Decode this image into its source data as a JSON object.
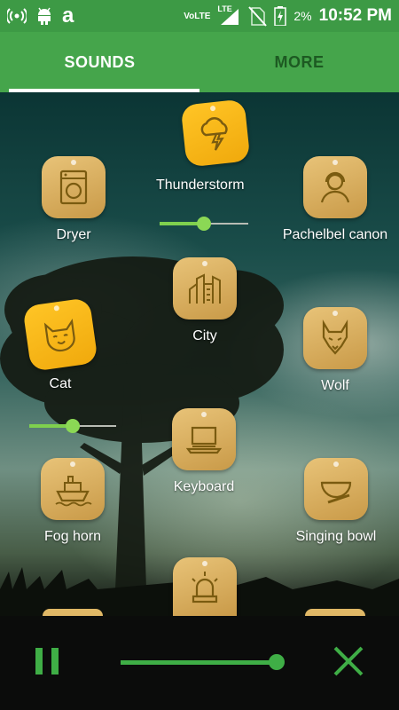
{
  "status_bar": {
    "left_icons": [
      "wifi-hotspot-icon",
      "android-icon",
      "amazon-icon"
    ],
    "amazon_glyph": "a",
    "volte": "VoLTE",
    "lte": "LTE",
    "battery_percent": "2%",
    "time": "10:52 PM"
  },
  "tabs": [
    {
      "label": "SOUNDS",
      "active": true
    },
    {
      "label": "MORE",
      "active": false
    }
  ],
  "sounds": {
    "thunderstorm": {
      "label": "Thunderstorm",
      "active": true,
      "icon": "thunderstorm-icon",
      "volume": 0.5
    },
    "dryer": {
      "label": "Dryer",
      "active": false,
      "icon": "dryer-icon"
    },
    "pachelbel": {
      "label": "Pachelbel canon",
      "active": false,
      "icon": "headset-person-icon"
    },
    "city": {
      "label": "City",
      "active": false,
      "icon": "city-buildings-icon"
    },
    "cat": {
      "label": "Cat",
      "active": true,
      "icon": "cat-icon",
      "volume": 0.5
    },
    "wolf": {
      "label": "Wolf",
      "active": false,
      "icon": "wolf-icon"
    },
    "keyboard": {
      "label": "Keyboard",
      "active": false,
      "icon": "laptop-keyboard-icon"
    },
    "foghorn": {
      "label": "Fog horn",
      "active": false,
      "icon": "ship-icon"
    },
    "singing_bowl": {
      "label": "Singing bowl",
      "active": false,
      "icon": "singing-bowl-icon"
    },
    "siren": {
      "active": false,
      "icon": "siren-icon"
    }
  },
  "player": {
    "pause_icon": "pause-icon",
    "close_icon": "close-icon",
    "master_volume": 0.9
  },
  "colors": {
    "primary_green": "#45a54b",
    "active_tile": "#ffc526",
    "inactive_tile": "#e0b866",
    "slider_green": "#7fd04e"
  }
}
